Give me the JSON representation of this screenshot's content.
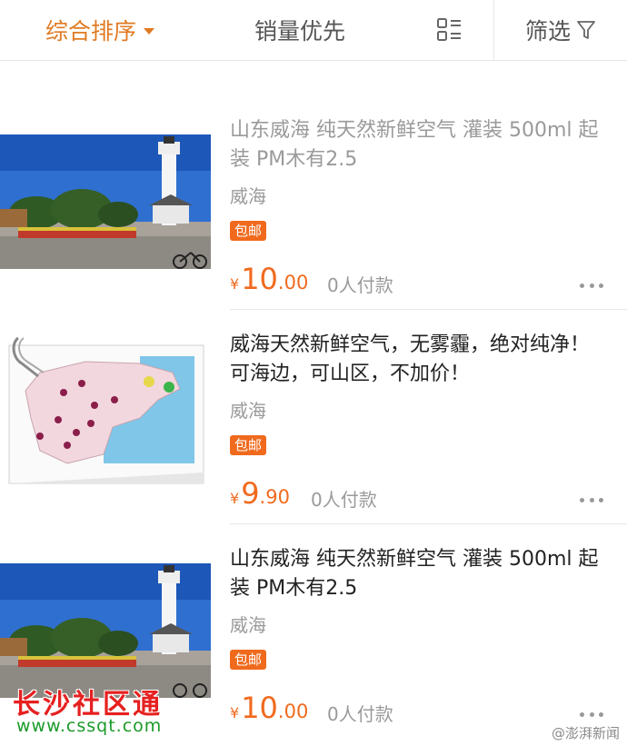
{
  "toolbar": {
    "sort_label": "综合排序",
    "sales_label": "销量优先",
    "filter_label": "筛选",
    "view_icon": "list-view-icon",
    "filter_icon": "funnel-icon"
  },
  "accent_color": "#f06a1e",
  "products": [
    {
      "title": "山东威海 纯天然新鲜空气 灌装 500ml 起装 PM木有2.5",
      "location": "威海",
      "tag": "包邮",
      "price_symbol": "¥",
      "price_int": "10",
      "price_dec": ".00",
      "paid": "0人付款",
      "thumbnail": "lighthouse-photo"
    },
    {
      "title": "威海天然新鲜空气，无雾霾，绝对纯净！可海边，可山区，不加价！",
      "location": "威海",
      "tag": "包邮",
      "price_symbol": "¥",
      "price_int": "9",
      "price_dec": ".90",
      "paid": "0人付款",
      "thumbnail": "shandong-map"
    },
    {
      "title": "山东威海 纯天然新鲜空气 灌装 500ml 起装 PM木有2.5",
      "location": "威海",
      "tag": "包邮",
      "price_symbol": "¥",
      "price_int": "10",
      "price_dec": ".00",
      "paid": "0人付款",
      "thumbnail": "lighthouse-photo"
    }
  ],
  "watermark": {
    "site_name": "长沙社区通",
    "site_url": "www.cssqt.com",
    "credit": "@澎湃新闻"
  }
}
